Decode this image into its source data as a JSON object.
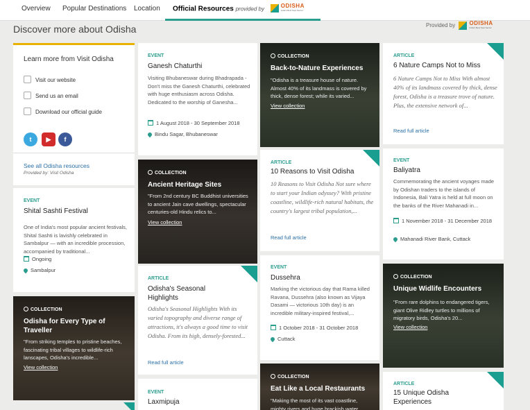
{
  "nav": {
    "tabs": [
      "Overview",
      "Popular Destinations",
      "Location",
      "Official Resources"
    ],
    "provided_by": "provided by",
    "logo_name": "ODISHA",
    "logo_tagline": "India's Best Kept Secret"
  },
  "heading": "Discover more about Odisha",
  "provided_by_label": "Provided by",
  "sidebar": {
    "title": "Learn more from Visit Odisha",
    "items": [
      "Visit our website",
      "Send us an email",
      "Download our official guide"
    ],
    "social": [
      "twitter-icon",
      "youtube-icon",
      "facebook-icon"
    ],
    "see_all": "See all Odisha resources",
    "provided": "Provided by: Visit Odisha"
  },
  "colors": {
    "accent": "#2a9d8f",
    "link": "#2a6fa6",
    "highlight": "#e9b200"
  },
  "cards": {
    "shitalsashti": {
      "type": "EVENT",
      "title": "Shital Sashti Festival",
      "text": "One of India's most popular ancient festivals, Shital Sashti is lavishly celebrated in Sambalpur — with an incredible procession, accompanied by traditional...",
      "date": "Ongoing",
      "place": "Sambalpur"
    },
    "everytype": {
      "type": "COLLECTION",
      "title": "Odisha for Every Type of Traveller",
      "text": "\"From striking temples to pristine beaches, fascinating tribal villages to wildlife-rich lanscapes, Odisha's incredible...",
      "link": "View collection"
    },
    "ganesh": {
      "type": "EVENT",
      "title": "Ganesh Chaturthi",
      "text": "Visiting Bhubaneswar during Bhadrapada - Don't miss the Ganesh Chaturthi, celebrated with huge enthusiasm across Odisha. Dedicated to the worship of Ganesha...",
      "date": "1 August 2018 - 30 September 2018",
      "place": "Bindu Sagar, Bhubaneswar"
    },
    "heritage": {
      "type": "COLLECTION",
      "title": "Ancient Heritage Sites",
      "text": "\"From 2nd century BC Buddhist universities to ancient Jain cave dwellings, spectacular centuries-old Hindu relics to...",
      "link": "View collection"
    },
    "seasonal": {
      "type": "ARTICLE",
      "title": "Odisha's Seasonal Highlights",
      "text": "Odisha's Seasonal Highlights With its varied topography and diverse range of attractions, it's always a good time to visit Odisha. From its high, densely-forested...",
      "link": "Read full article"
    },
    "laxmipuja": {
      "type": "EVENT",
      "title": "Laxmipuja"
    },
    "backtonature": {
      "type": "COLLECTION",
      "title": "Back-to-Nature Experiences",
      "text": "\"Odisha is a treasure house of nature. Almost 40% of its landmass is covered by thick, dense forest; while its varied...",
      "link": "View collection"
    },
    "tenreasons": {
      "type": "ARTICLE",
      "title": "10 Reasons to Visit Odisha",
      "text": "10 Reasons to Visit Odisha Not sure where to start your Indian odyssey? With pristine coastline, wildlife-rich natural habitats, the country's largest tribal population,...",
      "link": "Read full article"
    },
    "dussehra": {
      "type": "EVENT",
      "title": "Dussehra",
      "text": "Marking the victorious day that Rama killed Ravana, Dussehra (also known as Vijaya Dasami — victorious 10th day) is an incredible military-inspired festival,...",
      "date": "1 October 2018 - 31 October 2018",
      "place": "Cuttack"
    },
    "eatlocal": {
      "type": "COLLECTION",
      "title": "Eat Like a Local Restaurants",
      "text": "\"Making the most of its vast coastline, mighty rivers and huge brackish water"
    },
    "sixcamps": {
      "type": "ARTICLE",
      "title": "6 Nature Camps Not to Miss",
      "text": "6 Nature Camps Not to Miss With almost 40% of its landmass covered by thick, dense forest, Odisha is a treasure trove of nature. Plus, the extensive network of...",
      "link": "Read full article"
    },
    "baliyatra": {
      "type": "EVENT",
      "title": "Baliyatra",
      "text": "Commemorating the ancient voyages made by Odishan traders to the islands of Indonesia, Bali Yatra is held at full moon on the banks of the River Mahanadi in...",
      "date": "1 November 2018 - 31 December 2018",
      "place": "Mahanadi River Bank, Cuttack"
    },
    "wildlife": {
      "type": "COLLECTION",
      "title": "Unique Widlife Encounters",
      "text": "\"From rare dolphins to endangered tigers, giant Olive Ridley turtles to millions of migratory birds, Odisha's 20...",
      "link": "View collection"
    },
    "fifteen": {
      "type": "ARTICLE",
      "title": "15 Unique Odisha Experiences"
    }
  }
}
